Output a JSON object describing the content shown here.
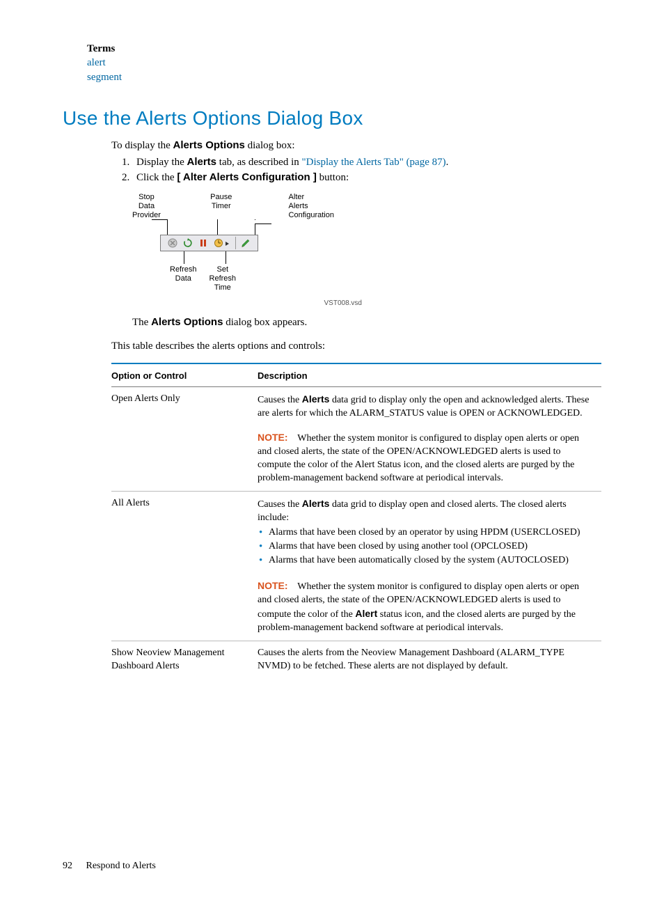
{
  "terms_block": {
    "heading": "Terms",
    "items": [
      "alert",
      "segment"
    ]
  },
  "section_title": "Use the Alerts Options Dialog Box",
  "lead_in": {
    "prefix": "To display the ",
    "bold": "Alerts Options",
    "suffix": " dialog box:"
  },
  "steps": [
    {
      "prefix": "Display the ",
      "bold": "Alerts",
      "mid": " tab, as described in ",
      "link": "\"Display the Alerts Tab\" (page 87)",
      "suffix": "."
    },
    {
      "prefix": "Click the ",
      "bold": "[ Alter Alerts Configuration ]",
      "mid": "",
      "link": "",
      "suffix": " button:"
    }
  ],
  "figure": {
    "top_labels": {
      "stop": "Stop\nData\nProvider",
      "pause": "Pause\nTimer",
      "alter": "Alter\nAlerts\nConfiguration"
    },
    "bottom_labels": {
      "refresh": "Refresh\nData",
      "set": "Set\nRefresh\nTime"
    },
    "caption": "VST008.vsd"
  },
  "after_figure": {
    "prefix": "The ",
    "bold": "Alerts Options",
    "suffix": " dialog box appears."
  },
  "table_intro": "This table describes the alerts options and controls:",
  "table": {
    "headers": {
      "col0": "Option or Control",
      "col1": "Description"
    },
    "note_label": "NOTE:",
    "rows": [
      {
        "option": "Open Alerts Only",
        "desc_pre": "Causes the ",
        "desc_bold": "Alerts",
        "desc_post": " data grid to display only the open and acknowledged alerts. These are alerts for which the ALARM_STATUS value is OPEN or ACKNOWLEDGED.",
        "note": " Whether the system monitor is configured to display open alerts or open and closed alerts, the state of the OPEN/ACKNOWLEDGED alerts is used to compute the color of the Alert Status icon, and the closed alerts are purged by the problem-management backend software at periodical intervals."
      },
      {
        "option": "All Alerts",
        "desc_pre": "Causes the ",
        "desc_bold": "Alerts",
        "desc_post": " data grid to display open and closed alerts. The closed alerts include:",
        "bullets": [
          "Alarms that have been closed by an operator by using HPDM (USERCLOSED)",
          "Alarms that have been closed by using another tool (OPCLOSED)",
          "Alarms that have been automatically closed by the system (AUTOCLOSED)"
        ],
        "note_pre": " Whether the system monitor is configured to display open alerts or open and closed alerts, the state of the OPEN/ACKNOWLEDGED alerts is used to compute the color of the ",
        "note_bold": "Alert",
        "note_post": " status icon, and the closed alerts are purged by the problem-management backend software at periodical intervals."
      },
      {
        "option": "Show Neoview Management Dashboard Alerts",
        "desc_plain": "Causes the alerts from the Neoview Management Dashboard (ALARM_TYPE NVMD) to be fetched. These alerts are not displayed by default."
      }
    ]
  },
  "footer": {
    "page": "92",
    "title": "Respond to Alerts"
  }
}
